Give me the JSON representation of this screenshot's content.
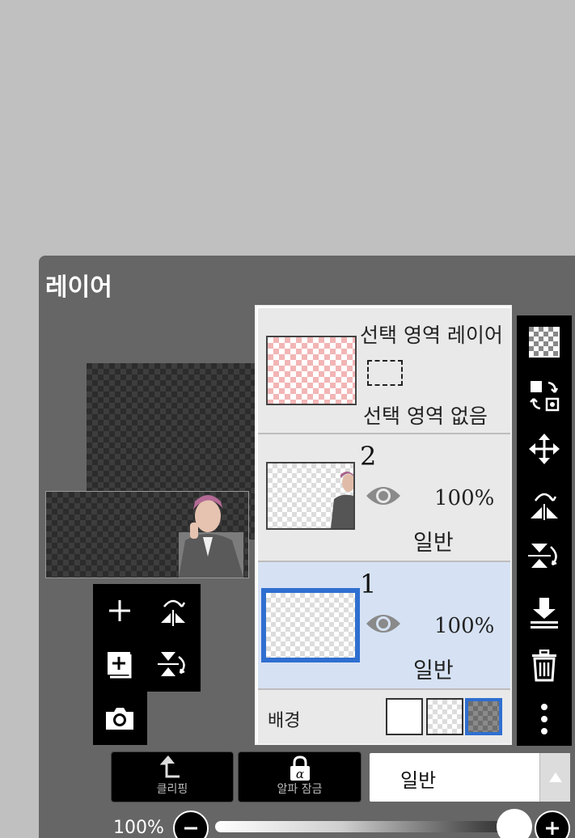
{
  "panel": {
    "title": "레이어"
  },
  "selection_layer": {
    "title": "선택 영역 레이어",
    "subtitle": "선택 영역 없음"
  },
  "layers": [
    {
      "number": "2",
      "opacity": "100%",
      "blend": "일반",
      "selected": false
    },
    {
      "number": "1",
      "opacity": "100%",
      "blend": "일반",
      "selected": true
    }
  ],
  "background": {
    "label": "배경",
    "options": [
      "white",
      "transparent",
      "dark-checker"
    ],
    "selected": "dark-checker"
  },
  "bottom": {
    "clipping_label": "클리핑",
    "alpha_lock_label": "알파 잠금",
    "blend_mode_value": "일반",
    "opacity_value": "100%",
    "opacity_fraction": 1.0
  },
  "colors": {
    "accent": "#2f6fd0",
    "panel": "#666666",
    "toolbar": "#000000"
  },
  "icons": {
    "left_tools": [
      "add-layer-icon",
      "flip-horizontal-icon",
      "add-copy-layer-icon",
      "flip-vertical-icon",
      "camera-icon"
    ],
    "right_tools": [
      "transparent-layer-icon",
      "move-layer-icon",
      "move-icon",
      "flip-horizontal-icon",
      "flip-vertical-icon",
      "merge-down-icon",
      "trash-icon",
      "more-icon"
    ]
  }
}
